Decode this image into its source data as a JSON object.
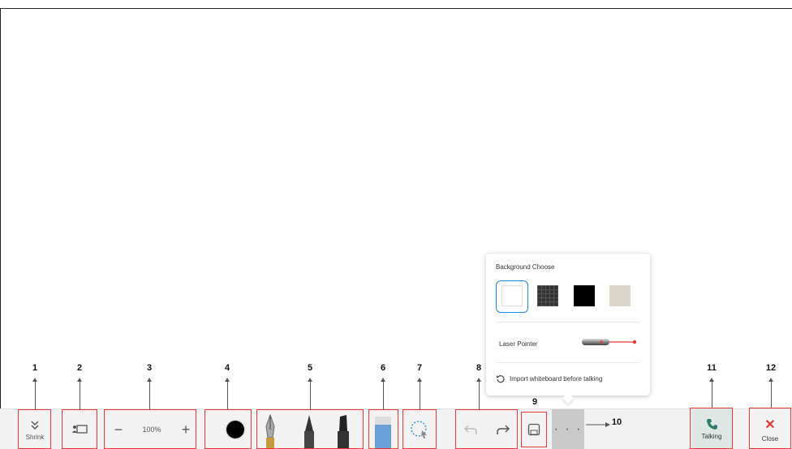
{
  "callouts": [
    "1",
    "2",
    "3",
    "4",
    "5",
    "6",
    "7",
    "8",
    "9",
    "10",
    "11",
    "12"
  ],
  "toolbar": {
    "shrink_label": "Shrink",
    "zoom_value": "100%",
    "talking_label": "Talking",
    "close_label": "Close",
    "more_label": "· · ·"
  },
  "popup": {
    "title": "Background Choose",
    "backgrounds": [
      "white",
      "grid-dark",
      "black",
      "beige"
    ],
    "selected_background": "white",
    "laser_label": "Laser Pointer",
    "import_label": "Import whiteboard before talking"
  },
  "colors": {
    "annotation_red": "#e53935",
    "accent_blue": "#1e88e5",
    "close_red": "#e53935",
    "talking_green": "#2e7d6d",
    "current_pen_color": "#000000"
  }
}
